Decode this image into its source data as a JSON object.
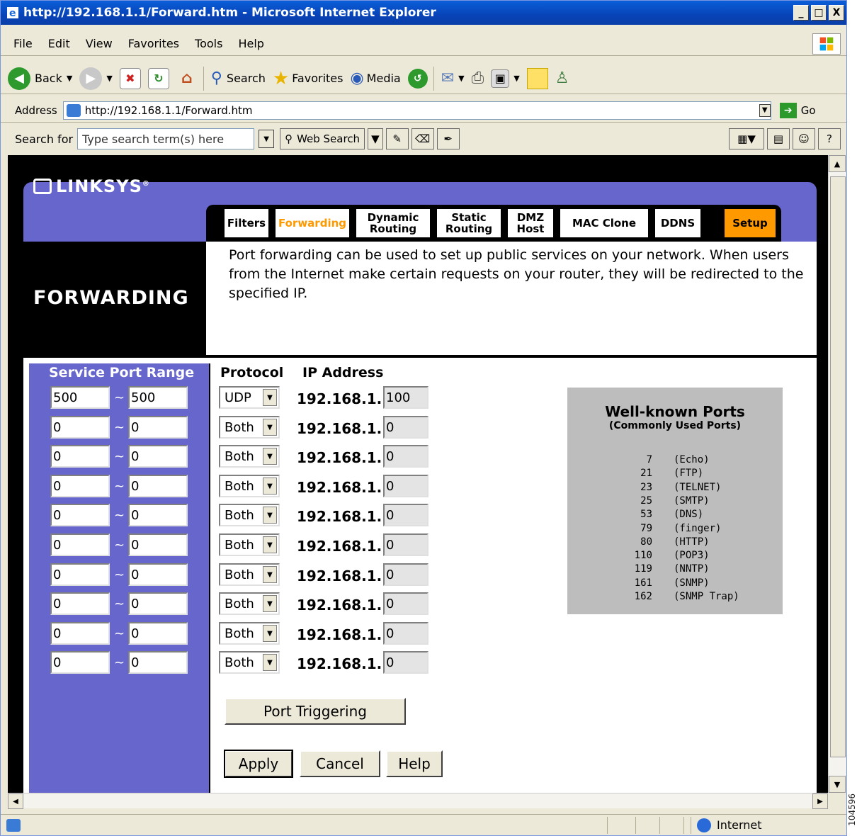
{
  "window": {
    "title": "http://192.168.1.1/Forward.htm - Microsoft Internet Explorer",
    "controls": [
      "_",
      "□",
      "X"
    ]
  },
  "menu": [
    "File",
    "Edit",
    "View",
    "Favorites",
    "Tools",
    "Help"
  ],
  "toolbar": {
    "back": "Back",
    "search": "Search",
    "favorites": "Favorites",
    "media": "Media"
  },
  "address": {
    "label": "Address",
    "url": "http://192.168.1.1/Forward.htm",
    "go": "Go"
  },
  "searchbar": {
    "label": "Search for",
    "placeholder": "Type search term(s) here",
    "web_search": "Web Search"
  },
  "page": {
    "logo": "LINKSYS",
    "logo_reg": "®",
    "heading": "FORWARDING",
    "tabs": [
      {
        "label": "Filters"
      },
      {
        "label": "Forwarding"
      },
      {
        "label": "Dynamic Routing"
      },
      {
        "label": "Static Routing"
      },
      {
        "label": "DMZ Host"
      },
      {
        "label": "MAC Clone"
      },
      {
        "label": "DDNS"
      },
      {
        "label": "Setup"
      }
    ],
    "description": "Port forwarding can be used to set up public services on your network. When users from the Internet make certain requests on your router, they will be redirected to the specified IP.",
    "headers": {
      "service_port_range": "Service Port Range",
      "protocol": "Protocol",
      "ip_address": "IP Address"
    },
    "range_separator": "~",
    "ip_prefix": "192.168.1.",
    "rows": [
      {
        "start": "500",
        "end": "500",
        "protocol": "UDP",
        "ip": "100"
      },
      {
        "start": "0",
        "end": "0",
        "protocol": "Both",
        "ip": "0"
      },
      {
        "start": "0",
        "end": "0",
        "protocol": "Both",
        "ip": "0"
      },
      {
        "start": "0",
        "end": "0",
        "protocol": "Both",
        "ip": "0"
      },
      {
        "start": "0",
        "end": "0",
        "protocol": "Both",
        "ip": "0"
      },
      {
        "start": "0",
        "end": "0",
        "protocol": "Both",
        "ip": "0"
      },
      {
        "start": "0",
        "end": "0",
        "protocol": "Both",
        "ip": "0"
      },
      {
        "start": "0",
        "end": "0",
        "protocol": "Both",
        "ip": "0"
      },
      {
        "start": "0",
        "end": "0",
        "protocol": "Both",
        "ip": "0"
      },
      {
        "start": "0",
        "end": "0",
        "protocol": "Both",
        "ip": "0"
      }
    ],
    "well_known": {
      "title": "Well-known Ports",
      "subtitle": "(Commonly Used Ports)",
      "ports": [
        {
          "num": "7",
          "name": "(Echo)"
        },
        {
          "num": "21",
          "name": "(FTP)"
        },
        {
          "num": "23",
          "name": "(TELNET)"
        },
        {
          "num": "25",
          "name": "(SMTP)"
        },
        {
          "num": "53",
          "name": "(DNS)"
        },
        {
          "num": "79",
          "name": "(finger)"
        },
        {
          "num": "80",
          "name": "(HTTP)"
        },
        {
          "num": "110",
          "name": "(POP3)"
        },
        {
          "num": "119",
          "name": "(NNTP)"
        },
        {
          "num": "161",
          "name": "(SNMP)"
        },
        {
          "num": "162",
          "name": "(SNMP Trap)"
        }
      ]
    },
    "buttons": {
      "port_triggering": "Port Triggering",
      "apply": "Apply",
      "cancel": "Cancel",
      "help": "Help"
    }
  },
  "status": {
    "zone": "Internet"
  },
  "side_label": "104596",
  "colors": {
    "linksys_purple": "#6666cc",
    "tab_active": "#ff9900",
    "titlebar": "#0a5fd8"
  }
}
